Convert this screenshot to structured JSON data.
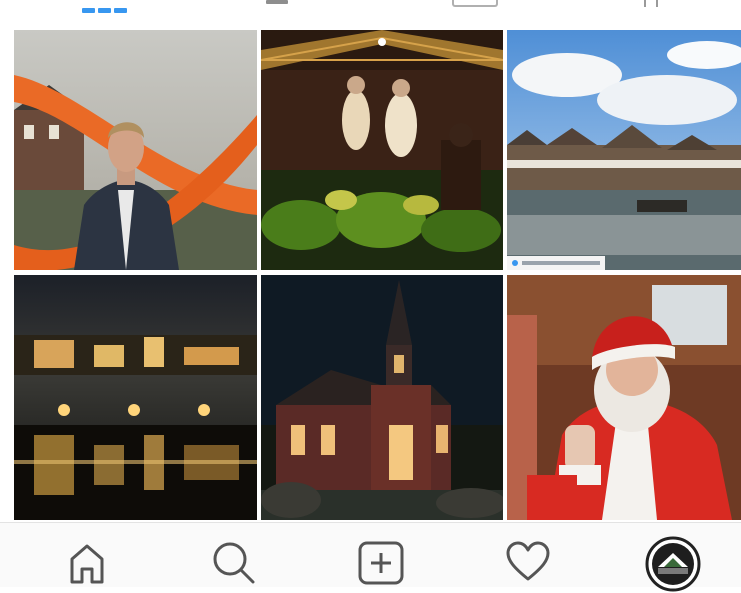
{
  "profile_tabs": {
    "icons": [
      "grid-icon",
      "list-icon",
      "igtv-icon",
      "tagged-icon"
    ],
    "active_tab": "grid-icon",
    "active_color": "#3897f0",
    "inactive_color": "#8e8e8e"
  },
  "posts": [
    {
      "icon": "photo-man-orange-slide"
    },
    {
      "icon": "photo-nativity-scene-lights"
    },
    {
      "icon": "photo-harbor-town-water",
      "tag_icon": "instagram-tag-icon"
    },
    {
      "icon": "photo-night-lights-reflection"
    },
    {
      "icon": "photo-lit-church-night"
    },
    {
      "icon": "photo-santa-waving"
    }
  ],
  "bottom_nav": {
    "items": [
      "home-icon",
      "search-icon",
      "add-post-icon",
      "heart-icon",
      "profile-avatar"
    ],
    "icon_color": "#555555",
    "background": "#fafafa"
  }
}
